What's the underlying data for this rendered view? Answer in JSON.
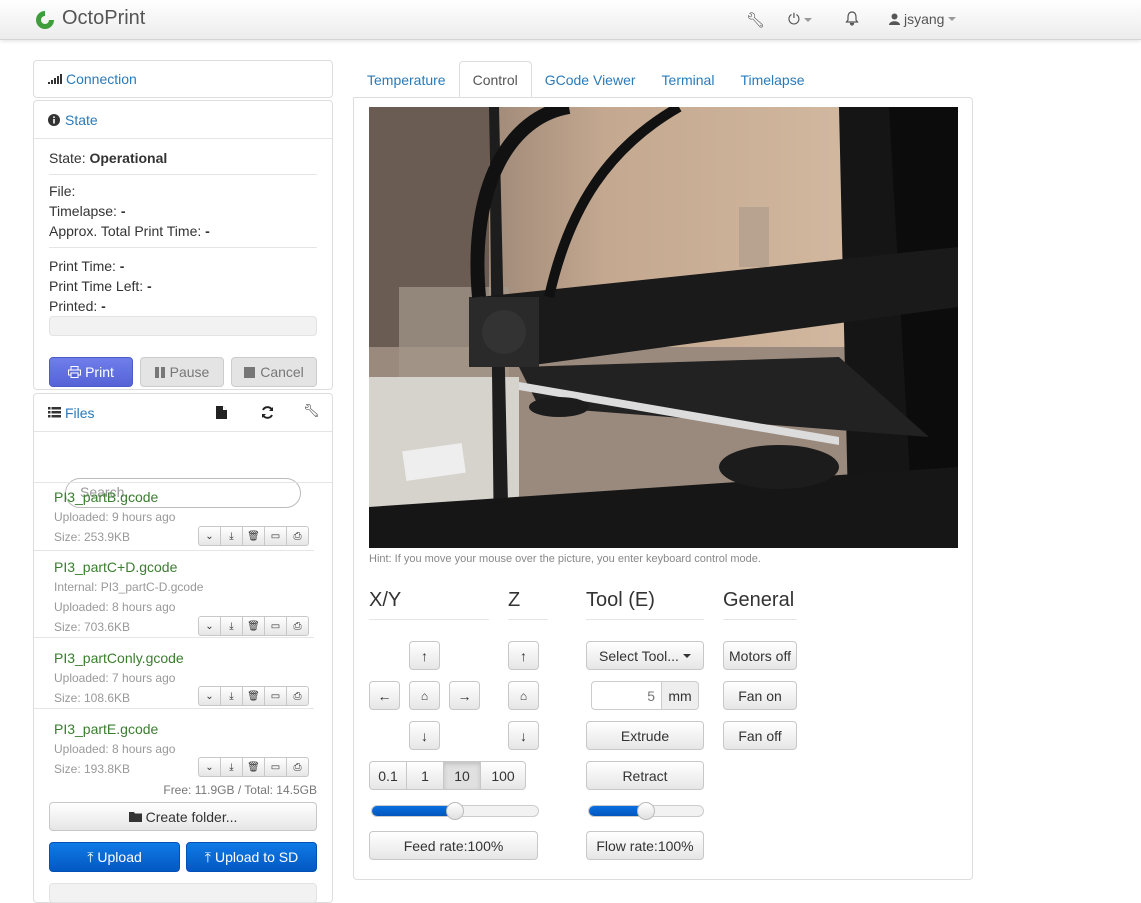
{
  "app": {
    "title": "OctoPrint",
    "brand_color": "#4caf50"
  },
  "navbar": {
    "user": "jsyang",
    "icons": [
      "wrench-icon",
      "power-icon",
      "bell-icon",
      "user-icon"
    ]
  },
  "sidebar": {
    "connection": {
      "label": "Connection"
    },
    "state": {
      "label": "State",
      "state_label": "State:",
      "state_value": "Operational",
      "file_label": "File:",
      "timelapse_label": "Timelapse:",
      "timelapse_value": "-",
      "approx_label": "Approx. Total Print Time:",
      "approx_value": "-",
      "print_time_label": "Print Time:",
      "print_time_value": "-",
      "time_left_label": "Print Time Left:",
      "time_left_value": "-",
      "printed_label": "Printed:",
      "printed_value": "-",
      "progress": 0,
      "buttons": {
        "print": "Print",
        "pause": "Pause",
        "cancel": "Cancel"
      }
    },
    "files": {
      "label": "Files",
      "search_placeholder": "Search...",
      "items": [
        {
          "name": "PI3_partB.gcode",
          "internal": "",
          "uploaded": "Uploaded: 9 hours ago",
          "size": "Size: 253.9KB"
        },
        {
          "name": "PI3_partC+D.gcode",
          "internal": "Internal: PI3_partC-D.gcode",
          "uploaded": "Uploaded: 8 hours ago",
          "size": "Size: 703.6KB"
        },
        {
          "name": "PI3_partConly.gcode",
          "internal": "",
          "uploaded": "Uploaded: 7 hours ago",
          "size": "Size: 108.6KB"
        },
        {
          "name": "PI3_partE.gcode",
          "internal": "",
          "uploaded": "Uploaded: 8 hours ago",
          "size": "Size: 193.8KB"
        }
      ],
      "free_total": "Free: 11.9GB / Total: 14.5GB",
      "create_folder": "Create folder...",
      "upload": "Upload",
      "upload_sd": "Upload to SD"
    }
  },
  "tabs": [
    {
      "label": "Temperature",
      "active": false
    },
    {
      "label": "Control",
      "active": true
    },
    {
      "label": "GCode Viewer",
      "active": false
    },
    {
      "label": "Terminal",
      "active": false
    },
    {
      "label": "Timelapse",
      "active": false
    }
  ],
  "control": {
    "hint": "Hint: If you move your mouse over the picture, you enter keyboard control mode.",
    "xy_title": "X/Y",
    "z_title": "Z",
    "tool_title": "Tool (E)",
    "general_title": "General",
    "step_sizes": [
      "0.1",
      "1",
      "10",
      "100"
    ],
    "active_step": "10",
    "feed_rate": "Feed rate:100%",
    "feed_rate_value": 0.5,
    "flow_rate": "Flow rate:100%",
    "flow_rate_value": 0.5,
    "select_tool": "Select Tool...",
    "extrude_amount": "5",
    "extrude_unit": "mm",
    "extrude": "Extrude",
    "retract": "Retract",
    "motors_off": "Motors off",
    "fan_on": "Fan on",
    "fan_off": "Fan off"
  }
}
